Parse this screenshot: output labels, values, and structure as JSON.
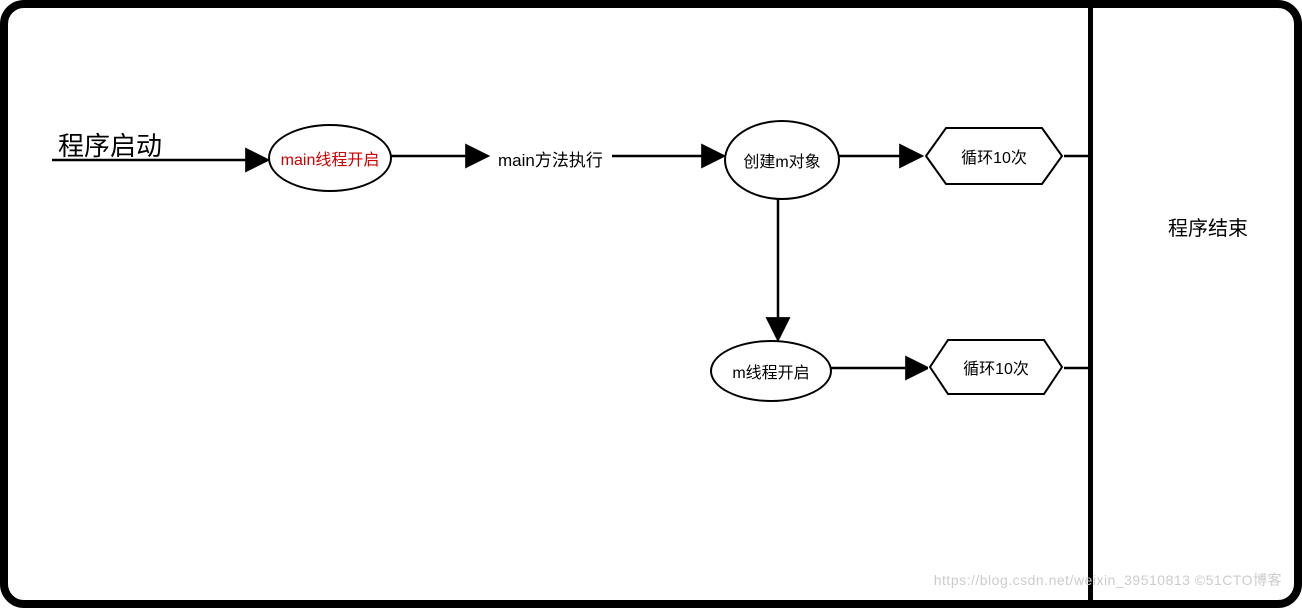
{
  "nodes": {
    "start_label": "程序启动",
    "main_thread_start": "main线程开启",
    "main_method_exec": "main方法执行",
    "create_m_object": "创建m对象",
    "loop_top": "循环10次",
    "m_thread_start": "m线程开启",
    "loop_bottom": "循环10次",
    "end_label": "程序结束"
  },
  "watermark": "https://blog.csdn.net/weixin_39510813  ©51CTO博客"
}
